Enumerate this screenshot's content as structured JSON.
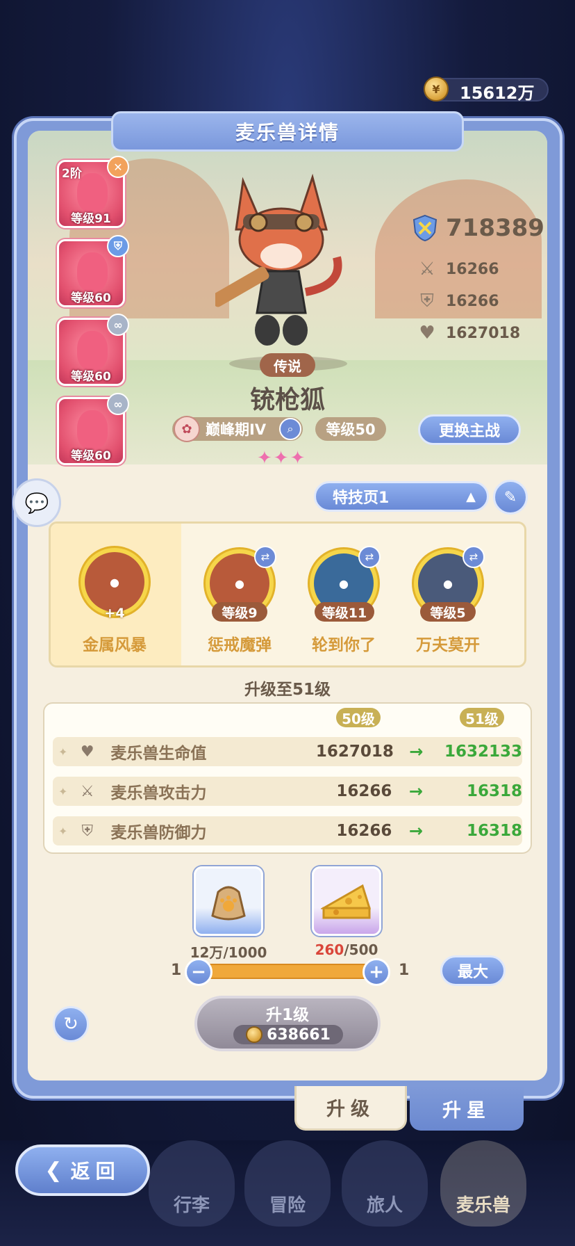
{
  "currency": {
    "amount": "15612万"
  },
  "header": {
    "title": "麦乐兽详情"
  },
  "forms": [
    {
      "stage": "2阶",
      "level": "等级91",
      "badge_icon": "cross-swords-icon",
      "badge_color": "#f2a25c"
    },
    {
      "stage": "",
      "level": "等级60",
      "badge_icon": "shield-icon",
      "badge_color": "#6c9be6"
    },
    {
      "stage": "",
      "level": "等级60",
      "badge_icon": "link-icon",
      "badge_color": "#a8b4c8"
    },
    {
      "stage": "",
      "level": "等级60",
      "badge_icon": "link-icon",
      "badge_color": "#a8b4c8"
    }
  ],
  "pet": {
    "rarity": "传说",
    "name": "铳枪狐",
    "stage": "巅峰期IV",
    "level": "等级50",
    "stars": "✦✦✦",
    "change_button": "更换主战"
  },
  "stats": {
    "power": "718389",
    "attack": "16266",
    "defense": "16266",
    "hp": "1627018"
  },
  "skill_page": {
    "label": "特技页1"
  },
  "skills": [
    {
      "name": "金属风暴",
      "level": "+4",
      "main": true,
      "icon_color": "#b85a3a"
    },
    {
      "name": "惩戒魔弹",
      "level": "等级9",
      "icon_color": "#b85a3a"
    },
    {
      "name": "轮到你了",
      "level": "等级11",
      "icon_color": "#3a6a9a"
    },
    {
      "name": "万夫莫开",
      "level": "等级5",
      "icon_color": "#4a5a7a"
    }
  ],
  "upgrade": {
    "title": "升级至51级",
    "current_level_label": "50级",
    "next_level_label": "51级",
    "rows": [
      {
        "icon": "heart-icon",
        "label": "麦乐兽生命值",
        "current": "1627018",
        "next": "1632133"
      },
      {
        "icon": "cross-swords-icon",
        "label": "麦乐兽攻击力",
        "current": "16266",
        "next": "16318"
      },
      {
        "icon": "shield-icon",
        "label": "麦乐兽防御力",
        "current": "16266",
        "next": "16318"
      }
    ]
  },
  "materials": [
    {
      "name": "food-bag-icon",
      "have": "12万",
      "need": "/1000",
      "enough": true
    },
    {
      "name": "cheese-icon",
      "have": "260",
      "need": "/500",
      "enough": false
    }
  ],
  "slider": {
    "min": "1",
    "max": "1",
    "max_button": "最大"
  },
  "level_up": {
    "label": "升1级",
    "cost": "638661"
  },
  "tabs": {
    "upgrade": "升级",
    "star": "升星"
  },
  "nav": {
    "back": "返回",
    "items": [
      "行李",
      "冒险",
      "旅人",
      "麦乐兽"
    ]
  }
}
